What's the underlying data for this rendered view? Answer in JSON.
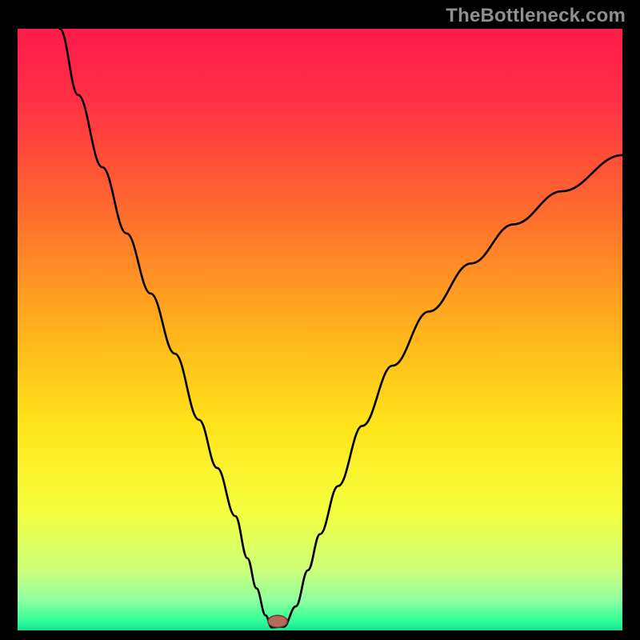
{
  "watermark": "TheBottleneck.com",
  "colors": {
    "frame": "#000000",
    "curve": "#000000",
    "gradient_stops": [
      {
        "offset": 0.0,
        "color": "#ff1b4b"
      },
      {
        "offset": 0.12,
        "color": "#ff3044"
      },
      {
        "offset": 0.3,
        "color": "#ff6a2e"
      },
      {
        "offset": 0.5,
        "color": "#ffb21c"
      },
      {
        "offset": 0.66,
        "color": "#ffe41a"
      },
      {
        "offset": 0.8,
        "color": "#f5ff3e"
      },
      {
        "offset": 0.9,
        "color": "#ccff7a"
      },
      {
        "offset": 0.95,
        "color": "#8fffa0"
      },
      {
        "offset": 0.985,
        "color": "#2fff97"
      },
      {
        "offset": 1.0,
        "color": "#17e08f"
      }
    ],
    "marker_fill": "#b56a5a",
    "marker_stroke": "#6b3a30"
  },
  "chart_data": {
    "type": "line",
    "title": "",
    "xlabel": "",
    "ylabel": "",
    "xlim": [
      0,
      100
    ],
    "ylim": [
      0,
      100
    ],
    "x_min_at": 42,
    "marker": {
      "cx": 43,
      "cy": 1.5,
      "rx": 1.6,
      "ry": 1.0
    },
    "series": [
      {
        "name": "bottleneck-curve",
        "x": [
          7,
          10,
          14,
          18,
          22,
          26,
          30,
          33,
          36,
          38,
          39.5,
          41,
          42,
          44,
          46,
          48,
          50,
          53,
          57,
          62,
          68,
          75,
          82,
          90,
          100
        ],
        "y": [
          100,
          89,
          77,
          66,
          56,
          46,
          35,
          27,
          19,
          12,
          7,
          2.5,
          0.5,
          0.6,
          4,
          10,
          16,
          24,
          34,
          44,
          53,
          61,
          67.5,
          73,
          79
        ]
      }
    ]
  }
}
